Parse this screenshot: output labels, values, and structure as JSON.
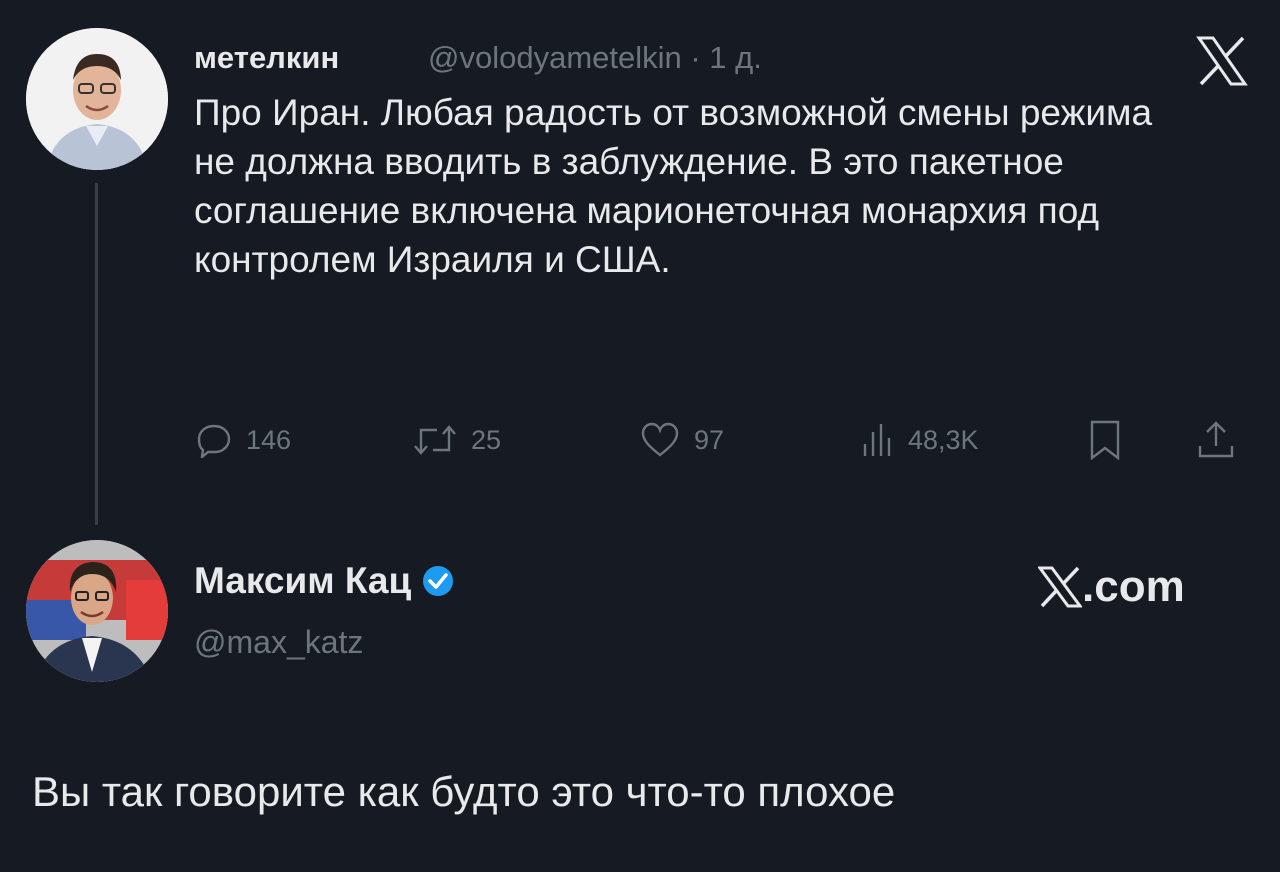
{
  "original_tweet": {
    "author_name": "метелкин",
    "handle_time": "@volodyametelkin · 1 д.",
    "text": "Про Иран. Любая радость от возможной смены режима не должна вводить в заблуждение. В это пакетное соглашение включена марионеточная монархия под контролем Израиля и США.",
    "stats": {
      "replies": "146",
      "retweets": "25",
      "likes": "97",
      "views": "48,3K"
    }
  },
  "reply": {
    "author_name": "Максим Кац",
    "handle": "@max_katz",
    "verified": true,
    "text": "Вы так говорите как будто это что-то плохое"
  },
  "branding": {
    "xcom_suffix": ".com"
  },
  "colors": {
    "background": "#151a23",
    "text": "#e7e9ea",
    "muted": "#6e767d",
    "verified": "#1d9bf0"
  }
}
